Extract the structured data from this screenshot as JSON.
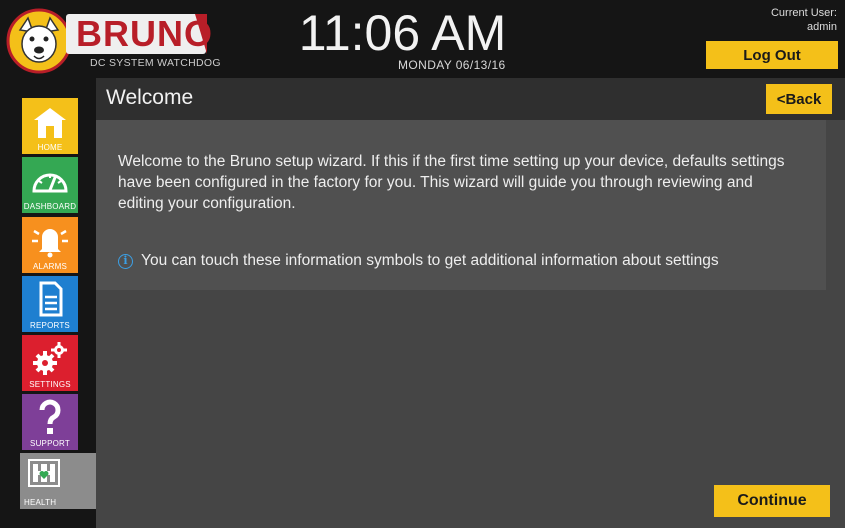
{
  "header": {
    "brand": "BRUNO",
    "tagline": "DC SYSTEM WATCHDOG",
    "time": "11:06 AM",
    "date": "MONDAY 06/13/16",
    "current_user_label": "Current User:",
    "current_user": "admin",
    "logout_label": "Log Out"
  },
  "sidebar": {
    "items": [
      {
        "label": "HOME",
        "icon": "home-icon",
        "color": "#f4c019"
      },
      {
        "label": "DASHBOARD",
        "icon": "gauge-icon",
        "color": "#34a853"
      },
      {
        "label": "ALARMS",
        "icon": "bell-icon",
        "color": "#f7901e"
      },
      {
        "label": "REPORTS",
        "icon": "document-icon",
        "color": "#1e7fd0"
      },
      {
        "label": "SETTINGS",
        "icon": "gears-icon",
        "color": "#dc1f2e"
      },
      {
        "label": "SUPPORT",
        "icon": "question-icon",
        "color": "#7e3f98"
      },
      {
        "label": "HEALTH",
        "icon": "health-icon",
        "color": "#8c8c8c"
      }
    ]
  },
  "main": {
    "title": "Welcome",
    "back_label": "<Back",
    "intro": "Welcome to the Bruno setup wizard. If this if the first time setting up your device, defaults settings have been configured in the factory for you. This wizard will guide you through reviewing and editing your configuration.",
    "info_text": "You can touch these information symbols to get additional information about settings",
    "info_icon": "i",
    "continue_label": "Continue"
  },
  "colors": {
    "accent": "#f4c019",
    "brand_red": "#b81e28",
    "info_blue": "#3ba0e6"
  }
}
